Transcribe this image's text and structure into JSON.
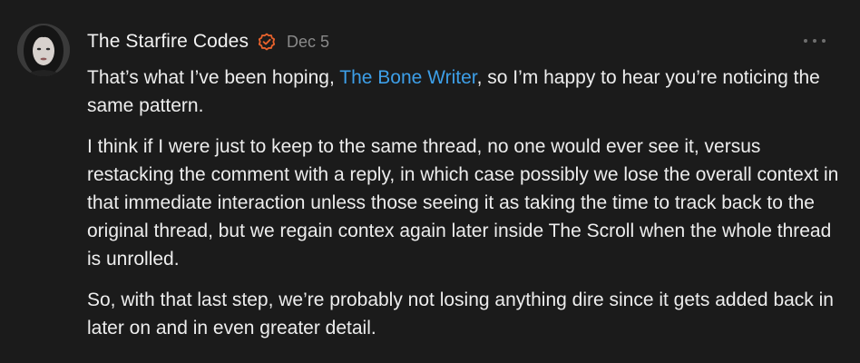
{
  "comment": {
    "author": "The Starfire Codes",
    "date": "Dec 5",
    "verified_icon": "verified-check-icon",
    "more_icon": "ellipsis-icon",
    "accent_color": "#e8622c",
    "link_color": "#3d9fe8",
    "paragraphs": {
      "p1_before": "That’s what I’ve been hoping, ",
      "p1_mention": "The Bone Writer",
      "p1_after": ", so I’m happy to hear you’re noticing the same pattern.",
      "p2": "I think if I were just to keep to the same thread, no one would ever see it, versus restacking the comment with a reply, in which case possibly we lose the overall context in that immediate interaction unless those seeing it as taking the time to track back to the original thread, but we regain contex again later inside The Scroll when the whole thread is unrolled.",
      "p3": "So, with that last step, we’re probably not losing anything dire since it gets added back in later on and in even greater detail."
    }
  }
}
